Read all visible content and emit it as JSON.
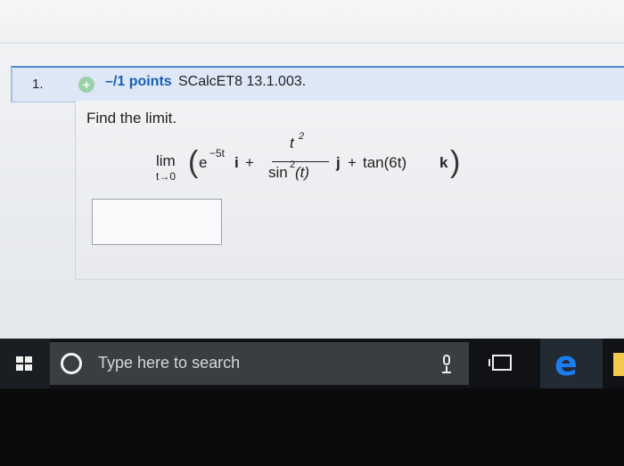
{
  "question": {
    "number": "1.",
    "points": "–/1 points",
    "source": "SCalcET8 13.1.003.",
    "prompt": "Find the limit.",
    "formula": {
      "lim": "lim",
      "lim_sub": "t→0",
      "paren_left": "(",
      "e": "e",
      "e_power": "−5t",
      "i": "i",
      "plus1": "+",
      "num": "t",
      "num_sup": "2",
      "den": "sin",
      "den_sup": "2",
      "den_arg": "(t)",
      "j": "j",
      "plus2": "+",
      "tan": "tan(6t)",
      "k": "k",
      "paren_right": ")"
    }
  },
  "answer": {
    "value": ""
  },
  "taskbar": {
    "search_placeholder": "Type here to search",
    "icons": {
      "start": "windows-logo",
      "cortana": "circle",
      "mic": "microphone",
      "task_view": "task-view",
      "edge": "edge-browser",
      "explorer": "folder"
    }
  }
}
